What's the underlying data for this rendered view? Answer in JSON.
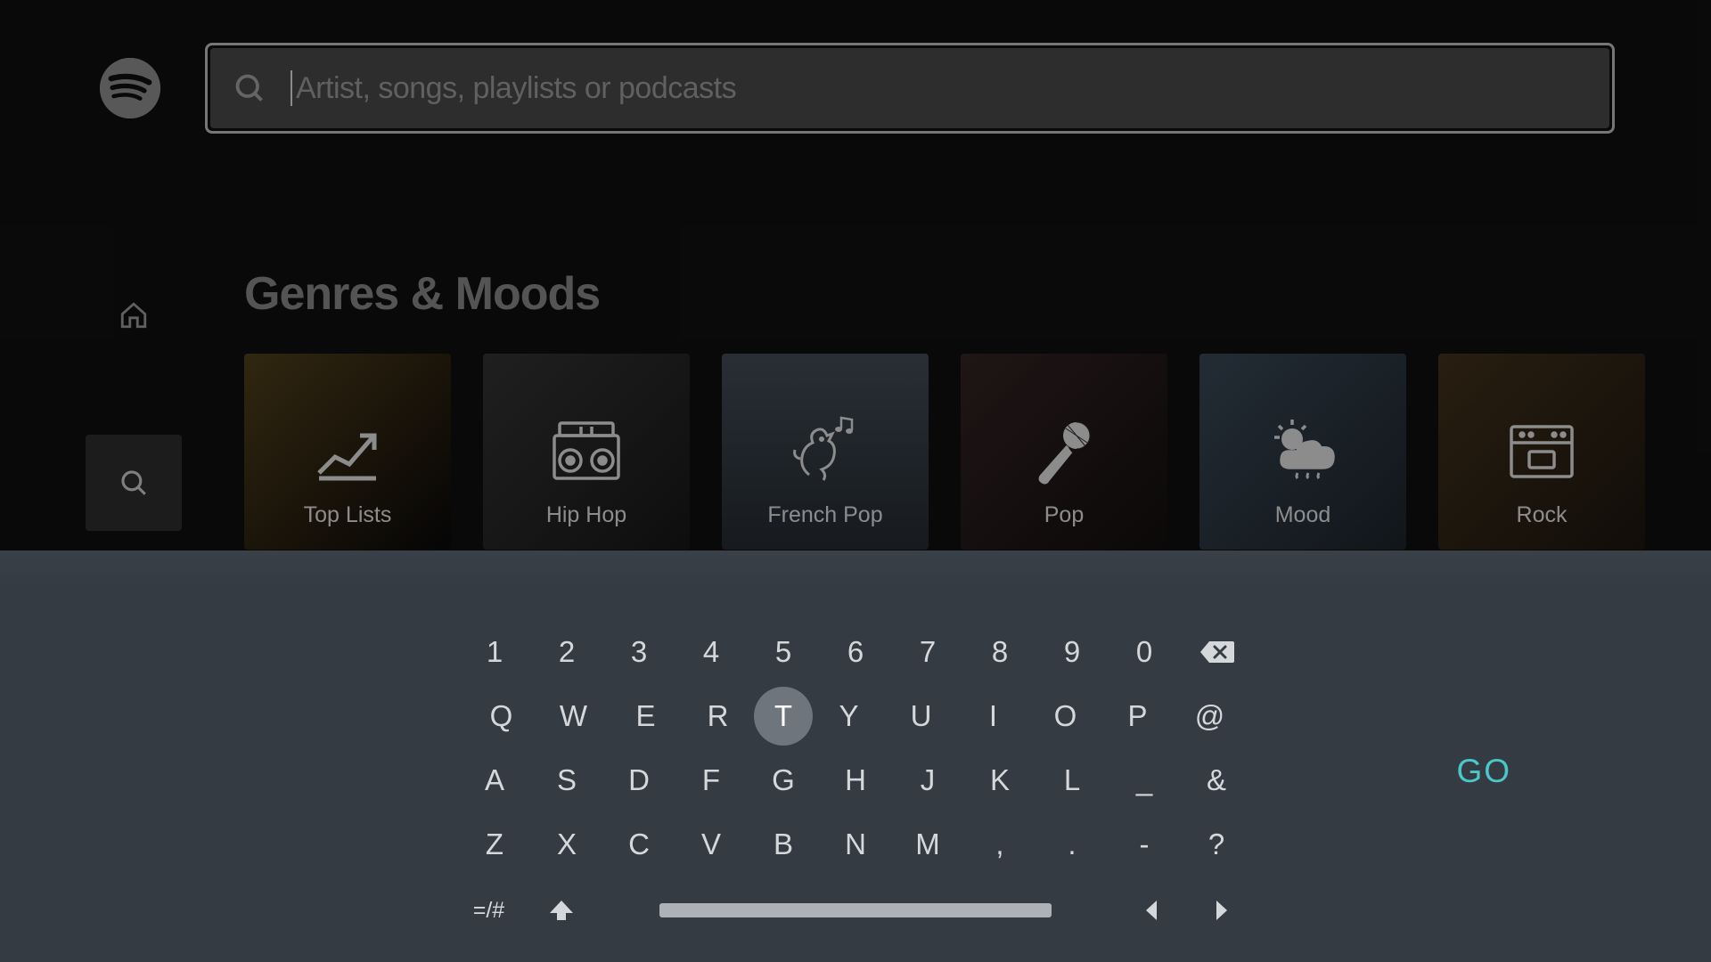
{
  "search": {
    "placeholder": "Artist, songs, playlists or podcasts",
    "value": ""
  },
  "section_title": "Genres & Moods",
  "sidebar": {
    "items": [
      {
        "id": "home"
      },
      {
        "id": "search"
      },
      {
        "id": "library"
      }
    ],
    "active_index": 1
  },
  "genres": [
    {
      "label": "Top Lists",
      "icon": "chart-up"
    },
    {
      "label": "Hip Hop",
      "icon": "boombox"
    },
    {
      "label": "French Pop",
      "icon": "rooster-music"
    },
    {
      "label": "Pop",
      "icon": "microphone"
    },
    {
      "label": "Mood",
      "icon": "weather"
    },
    {
      "label": "Rock",
      "icon": "amp"
    }
  ],
  "keyboard": {
    "rows": [
      [
        "1",
        "2",
        "3",
        "4",
        "5",
        "6",
        "7",
        "8",
        "9",
        "0",
        "⌫"
      ],
      [
        "Q",
        "W",
        "E",
        "R",
        "T",
        "Y",
        "U",
        "I",
        "O",
        "P",
        "@"
      ],
      [
        "A",
        "S",
        "D",
        "F",
        "G",
        "H",
        "J",
        "K",
        "L",
        "_",
        "&"
      ],
      [
        "Z",
        "X",
        "C",
        "V",
        "B",
        "N",
        "M",
        ",",
        ".",
        "-",
        "?"
      ]
    ],
    "focused_key": "T",
    "sym_label": "=/#",
    "go_label": "GO"
  }
}
